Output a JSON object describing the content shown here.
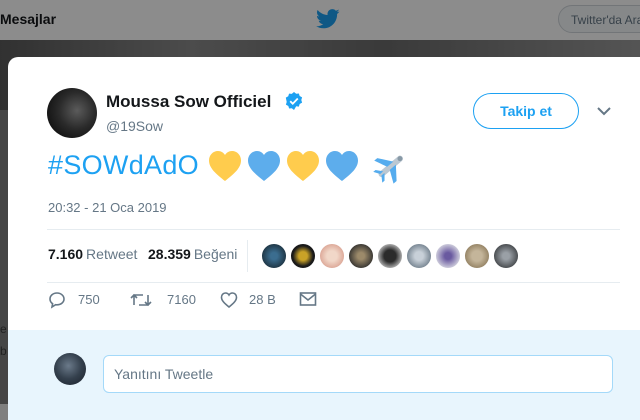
{
  "topbar": {
    "messages_label": "Mesajlar",
    "search_placeholder": "Twitter'da Ara"
  },
  "tweet": {
    "author_name": "Moussa Sow Officiel",
    "handle": "@19Sow",
    "verified": true,
    "follow_label": "Takip et",
    "hashtag": "#SOWdAdO",
    "emojis": [
      "yellow-heart",
      "blue-heart",
      "yellow-heart",
      "blue-heart",
      "airplane"
    ],
    "timestamp": "20:32 - 21 Oca 2019",
    "retweets_count": "7.160",
    "retweets_label": "Retweet",
    "likes_count": "28.359",
    "likes_label": "Beğeni",
    "actions": {
      "reply_count": "750",
      "retweet_count": "7160",
      "like_count": "28 B"
    }
  },
  "reply": {
    "placeholder": "Yanıtını Tweetle"
  },
  "side_fragments": [
    "e",
    "b"
  ],
  "colors": {
    "accent": "#1da1f2",
    "text": "#14171a",
    "muted": "#657786",
    "heart_yellow": "#ffcc4d",
    "heart_blue": "#5dadec"
  }
}
